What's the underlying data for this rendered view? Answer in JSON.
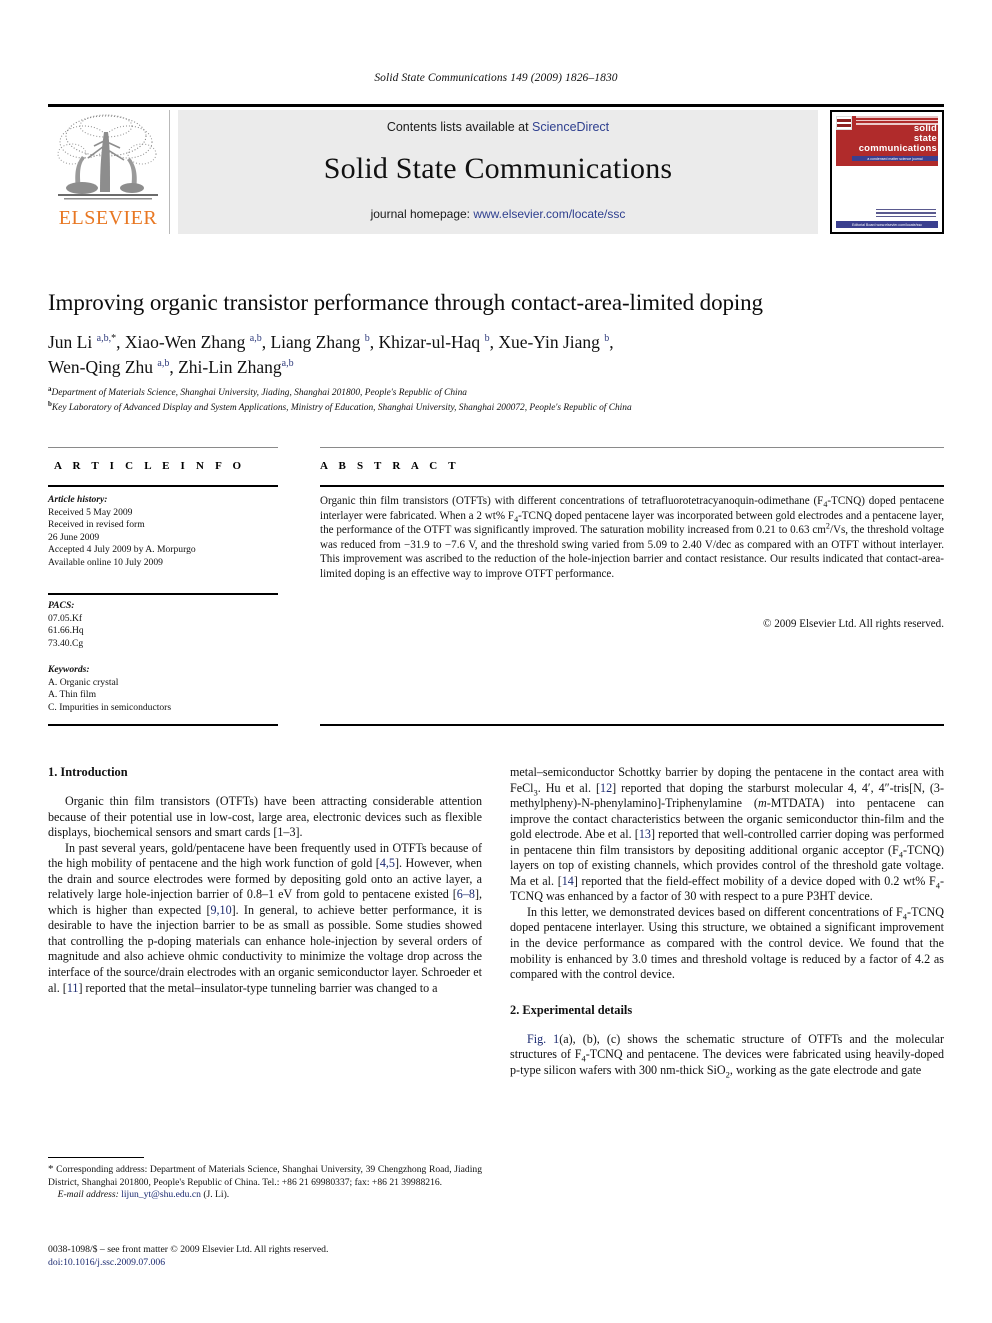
{
  "running_head": "Solid State Communications 149 (2009) 1826–1830",
  "masthead": {
    "contents_prefix": "Contents lists available at ",
    "sciencedirect": "ScienceDirect",
    "journal_title": "Solid State Communications",
    "homepage_prefix": "journal homepage: ",
    "homepage_url": "www.elsevier.com/locate/ssc",
    "publisher_wordmark": "ELSEVIER",
    "publisher_accent_color": "#E87722",
    "link_color": "#2e3f8f",
    "panel_color": "#ebebeb",
    "cover": {
      "line1": "solid",
      "line2": "state",
      "line3": "communications",
      "band_text": "a condensed matter science journal",
      "footer_text": "Editorial Board  www.elsevier.com/locate/ssc",
      "red": "#b02b2b",
      "blue": "#3a3f8f"
    }
  },
  "title": "Improving organic transistor performance through contact-area-limited doping",
  "authors_html": "Jun Li <sup>a,b,</sup><sup class=\"star\">*</sup>, Xiao-Wen Zhang <sup>a,b</sup>, Liang Zhang <sup>b</sup>, Khizar-ul-Haq <sup>b</sup>, Xue-Yin Jiang <sup>b</sup>,<br>Wen-Qing Zhu <sup>a,b</sup>, Zhi-Lin Zhang<sup>a,b</sup>",
  "affiliations": [
    {
      "mark": "a",
      "text": "Department of Materials Science, Shanghai University, Jiading, Shanghai 201800, People's Republic of China"
    },
    {
      "mark": "b",
      "text": "Key Laboratory of Advanced Display and System Applications, Ministry of Education, Shanghai University, Shanghai 200072, People's Republic of China"
    }
  ],
  "info": {
    "heading": "A R T I C L E   I N F O",
    "history_label": "Article history:",
    "history_lines": [
      "Received 5 May 2009",
      "Received in revised form",
      "26 June 2009",
      "Accepted 4 July 2009 by A. Morpurgo",
      "Available online 10 July 2009"
    ],
    "pacs_label": "PACS:",
    "pacs": [
      "07.05.Kf",
      "61.66.Hq",
      "73.40.Cg"
    ],
    "keywords_label": "Keywords:",
    "keywords": [
      "A. Organic crystal",
      "A. Thin film",
      "C. Impurities in semiconductors"
    ]
  },
  "abstract": {
    "heading": "A B S T R A C T",
    "body_html": "Organic thin film transistors (OTFTs) with different concentrations of tetrafluorotetracyanoquin-odimethane (F<sub>4</sub>-TCNQ) doped pentacene interlayer were fabricated. When a 2 wt% F<sub>4</sub>-TCNQ doped pentacene layer was incorporated between gold electrodes and a pentacene layer, the performance of the OTFT was significantly improved. The saturation mobility increased from 0.21 to 0.63 cm<sup>2</sup>/Vs, the threshold voltage was reduced from &minus;31.9 to &minus;7.6 V, and the threshold swing varied from 5.09 to 2.40 V/dec as compared with an OTFT without interlayer. This improvement was ascribed to the reduction of the hole-injection barrier and contact resistance. Our results indicated that contact-area-limited doping is an effective way to improve OTFT performance.",
    "copyright": "© 2009 Elsevier Ltd. All rights reserved."
  },
  "sections": {
    "intro_heading": "1. Introduction",
    "intro_p1": "Organic thin film transistors (OTFTs) have been attracting considerable attention because of their potential use in low-cost, large area, electronic devices such as flexible displays, biochemical sensors and smart cards [1–3].",
    "intro_p2_html": "In past several years, gold/pentacene have been frequently used in OTFTs because of the high mobility of pentacene and the high work function of gold [<span class=\"ref\">4,5</span>]. However, when the drain and source electrodes were formed by depositing gold onto an active layer, a relatively large hole-injection barrier of 0.8–1 eV from gold to pentacene existed [<span class=\"ref\">6–8</span>], which is higher than expected [<span class=\"ref\">9,10</span>]. In general, to achieve better performance, it is desirable to have the injection barrier to be as small as possible. Some studies showed that controlling the p-doping materials can enhance hole-injection by several orders of magnitude and also achieve ohmic conductivity to minimize the voltage drop across the interface of the source/drain electrodes with an organic semiconductor layer. Schroeder et al. [<span class=\"ref\">11</span>] reported that the metal–insulator-type tunneling barrier was changed to a",
    "right_p1_html": "metal–semiconductor Schottky barrier by doping the pentacene in the contact area with FeCl<sub>3</sub>. Hu et al. [<span class=\"ref\">12</span>] reported that doping the starburst molecular 4, 4&prime;, 4&Prime;-tris[N, (3-methylpheny)-N-phenylamino]-Triphenylamine (<i>m</i>-MTDATA) into pentacene can improve the contact characteristics between the organic semiconductor thin-film and the gold electrode. Abe et al. [<span class=\"ref\">13</span>] reported that well-controlled carrier doping was performed in pentacene thin film transistors by depositing additional organic acceptor (F<sub>4</sub>-TCNQ) layers on top of existing channels, which provides control of the threshold gate voltage. Ma et al. [<span class=\"ref\">14</span>] reported that the field-effect mobility of a device doped with 0.2 wt% F<sub>4</sub>-TCNQ was enhanced by a factor of 30 with respect to a pure P3HT device.",
    "right_p2_html": "In this letter, we demonstrated devices based on different concentrations of F<sub>4</sub>-TCNQ doped pentacene interlayer. Using this structure, we obtained a significant improvement in the device performance as compared with the control device. We found that the mobility is enhanced by 3.0 times and threshold voltage is reduced by a factor of 4.2 as compared with the control device.",
    "exp_heading": "2. Experimental details",
    "exp_p1_html": "<span class=\"ref\">Fig. 1</span>(a), (b), (c) shows the schematic structure of OTFTs and the molecular structures of F<sub>4</sub>-TCNQ and pentacene. The devices were fabricated using heavily-doped p-type silicon wafers with 300 nm-thick SiO<sub>2</sub>, working as the gate electrode and gate"
  },
  "footnote": {
    "marker": "*",
    "text": "Corresponding address: Department of Materials Science, Shanghai University, 39 Chengzhong Road, Jiading District, Shanghai 201800, People's Republic of China. Tel.: +86 21 69980337; fax: +86 21 39988216.",
    "email_label": "E-mail address:",
    "email": "lijun_yt@shu.edu.cn",
    "email_suffix": "(J. Li)."
  },
  "issn_line": "0038-1098/$ – see front matter © 2009 Elsevier Ltd. All rights reserved.",
  "doi_line": "doi:10.1016/j.ssc.2009.07.006"
}
